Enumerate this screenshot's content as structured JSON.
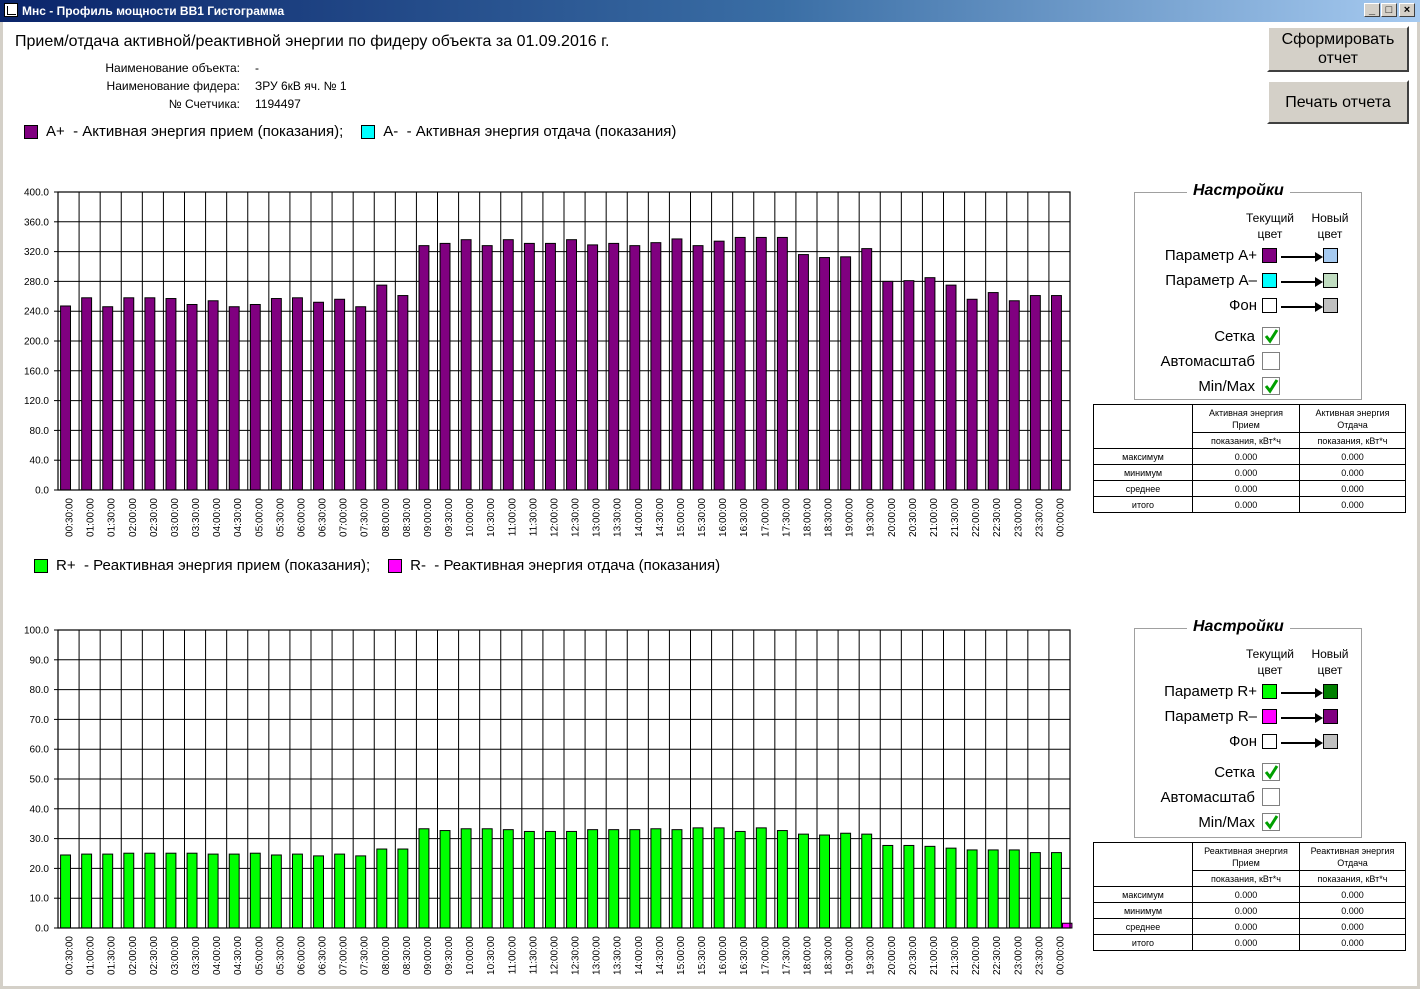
{
  "window": {
    "title": "Мнс - Профиль мощности ВВ1 Гистограмма",
    "minimize": "_",
    "maximize": "□",
    "close": "×"
  },
  "header": {
    "text": "Прием/отдача активной/реактивной энергии  по фидеру объекта за",
    "date": "01.09.2016",
    "suffix": "г."
  },
  "info": {
    "object_label": "Наименование объекта:",
    "object_value": "-",
    "feeder_label": "Наименование фидера:",
    "feeder_value": "ЗРУ 6кВ яч. № 1",
    "meter_label": "№ Счетчика:",
    "meter_value": "1194497"
  },
  "buttons": {
    "generate": "Сформировать отчет",
    "print": "Печать отчета"
  },
  "legend_active": {
    "a_plus_code": "A+",
    "a_plus_text": "-  Активная энергия прием (показания);",
    "a_minus_code": "A-",
    "a_minus_text": "-  Активная энергия отдача (показания)"
  },
  "legend_reactive": {
    "r_plus_code": "R+",
    "r_plus_text": "-  Реактивная энергия прием (показания);",
    "r_minus_code": "R-",
    "r_minus_text": "-  Реактивная энергия отдача (показания)"
  },
  "settings_active": {
    "title": "Настройки",
    "current_color_1": "Текущий",
    "current_color_2": "цвет",
    "new_color_1": "Новый",
    "new_color_2": "цвет",
    "param1": "Параметр A+",
    "param2": "Параметр A–",
    "background": "Фон",
    "grid": "Сетка",
    "autoscale": "Автомасштаб",
    "minmax": "Min/Max",
    "grid_checked": true,
    "autoscale_checked": false,
    "minmax_checked": true,
    "colors": {
      "param1_current": "#800080",
      "param1_new": "#a6caf0",
      "param2_current": "#00ffff",
      "param2_new": "#c0dcc0",
      "bg_current": "#ffffff",
      "bg_new": "#c0c0c0"
    }
  },
  "settings_reactive": {
    "title": "Настройки",
    "current_color_1": "Текущий",
    "current_color_2": "цвет",
    "new_color_1": "Новый",
    "new_color_2": "цвет",
    "param1": "Параметр R+",
    "param2": "Параметр R–",
    "background": "Фон",
    "grid": "Сетка",
    "autoscale": "Автомасштаб",
    "minmax": "Min/Max",
    "grid_checked": true,
    "autoscale_checked": false,
    "minmax_checked": true,
    "colors": {
      "param1_current": "#00ff00",
      "param1_new": "#008000",
      "param2_current": "#ff00ff",
      "param2_new": "#800080",
      "bg_current": "#ffffff",
      "bg_new": "#c0c0c0"
    }
  },
  "stats_active": {
    "col1_line1": "Активная энергия",
    "col1_line2": "Прием",
    "col2_line1": "Активная энергия",
    "col2_line2": "Отдача",
    "unit": "показания, кВт*ч",
    "rows": [
      {
        "label": "максимум",
        "v1": "0.000",
        "v2": "0.000"
      },
      {
        "label": "минимум",
        "v1": "0.000",
        "v2": "0.000"
      },
      {
        "label": "среднее",
        "v1": "0.000",
        "v2": "0.000"
      },
      {
        "label": "итого",
        "v1": "0.000",
        "v2": "0.000"
      }
    ]
  },
  "stats_reactive": {
    "col1_line1": "Реактивная энергия",
    "col1_line2": "Прием",
    "col2_line1": "Реактивная энергия",
    "col2_line2": "Отдача",
    "unit": "показания, кВт*ч",
    "rows": [
      {
        "label": "максимум",
        "v1": "0.000",
        "v2": "0.000"
      },
      {
        "label": "минимум",
        "v1": "0.000",
        "v2": "0.000"
      },
      {
        "label": "среднее",
        "v1": "0.000",
        "v2": "0.000"
      },
      {
        "label": "итого",
        "v1": "0.000",
        "v2": "0.000"
      }
    ]
  },
  "chart_data": [
    {
      "type": "bar",
      "categories": [
        "00:30:00",
        "01:00:00",
        "01:30:00",
        "02:00:00",
        "02:30:00",
        "03:00:00",
        "03:30:00",
        "04:00:00",
        "04:30:00",
        "05:00:00",
        "05:30:00",
        "06:00:00",
        "06:30:00",
        "07:00:00",
        "07:30:00",
        "08:00:00",
        "08:30:00",
        "09:00:00",
        "09:30:00",
        "10:00:00",
        "10:30:00",
        "11:00:00",
        "11:30:00",
        "12:00:00",
        "12:30:00",
        "13:00:00",
        "13:30:00",
        "14:00:00",
        "14:30:00",
        "15:00:00",
        "15:30:00",
        "16:00:00",
        "16:30:00",
        "17:00:00",
        "17:30:00",
        "18:00:00",
        "18:30:00",
        "19:00:00",
        "19:30:00",
        "20:00:00",
        "20:30:00",
        "21:00:00",
        "21:30:00",
        "22:00:00",
        "22:30:00",
        "23:00:00",
        "23:30:00",
        "00:00:00"
      ],
      "series": [
        {
          "name": "A+",
          "color": "#800080",
          "values": [
            247,
            258,
            246,
            258,
            258,
            257,
            249,
            254,
            246,
            249,
            257,
            258,
            252,
            256,
            246,
            275,
            261,
            328,
            331,
            336,
            328,
            336,
            331,
            331,
            336,
            329,
            331,
            328,
            332,
            337,
            328,
            334,
            339,
            339,
            339,
            316,
            312,
            313,
            324,
            280,
            281,
            285,
            275,
            256,
            265,
            254,
            261,
            261
          ]
        },
        {
          "name": "A-",
          "color": "#00ffff",
          "values": [
            0,
            0,
            0,
            0,
            0,
            0,
            0,
            0,
            0,
            0,
            0,
            0,
            0,
            0,
            0,
            0,
            0,
            0,
            0,
            0,
            0,
            0,
            0,
            0,
            0,
            0,
            0,
            0,
            0,
            0,
            0,
            0,
            0,
            0,
            0,
            0,
            0,
            0,
            0,
            0,
            0,
            0,
            0,
            0,
            0,
            0,
            0,
            0
          ]
        }
      ],
      "ylim": [
        0,
        400
      ],
      "yticks": [
        "0.0",
        "40.0",
        "80.0",
        "120.0",
        "160.0",
        "200.0",
        "240.0",
        "280.0",
        "320.0",
        "360.0",
        "400.0"
      ],
      "grid": true
    },
    {
      "type": "bar",
      "categories": [
        "00:30:00",
        "01:00:00",
        "01:30:00",
        "02:00:00",
        "02:30:00",
        "03:00:00",
        "03:30:00",
        "04:00:00",
        "04:30:00",
        "05:00:00",
        "05:30:00",
        "06:00:00",
        "06:30:00",
        "07:00:00",
        "07:30:00",
        "08:00:00",
        "08:30:00",
        "09:00:00",
        "09:30:00",
        "10:00:00",
        "10:30:00",
        "11:00:00",
        "11:30:00",
        "12:00:00",
        "12:30:00",
        "13:00:00",
        "13:30:00",
        "14:00:00",
        "14:30:00",
        "15:00:00",
        "15:30:00",
        "16:00:00",
        "16:30:00",
        "17:00:00",
        "17:30:00",
        "18:00:00",
        "18:30:00",
        "19:00:00",
        "19:30:00",
        "20:00:00",
        "20:30:00",
        "21:00:00",
        "21:30:00",
        "22:00:00",
        "22:30:00",
        "23:00:00",
        "23:30:00",
        "00:00:00"
      ],
      "series": [
        {
          "name": "R+",
          "color": "#00ff00",
          "values": [
            24.5,
            24.8,
            24.8,
            25.1,
            25.1,
            25.1,
            25.1,
            24.8,
            24.8,
            25.1,
            24.5,
            24.8,
            24.2,
            24.8,
            24.2,
            26.5,
            26.5,
            33.3,
            32.7,
            33.3,
            33.3,
            33.0,
            32.4,
            32.4,
            32.4,
            33.0,
            33.0,
            33.0,
            33.3,
            33.0,
            33.6,
            33.6,
            32.4,
            33.6,
            32.7,
            31.5,
            31.2,
            31.8,
            31.5,
            27.7,
            27.7,
            27.4,
            26.8,
            26.2,
            26.2,
            26.2,
            25.3,
            25.3
          ]
        },
        {
          "name": "R-",
          "color": "#ff00ff",
          "values": [
            0,
            0,
            0,
            0,
            0,
            0,
            0,
            0,
            0,
            0,
            0,
            0,
            0,
            0,
            0,
            0,
            0,
            0,
            0,
            0,
            0,
            0,
            0,
            0,
            0,
            0,
            0,
            0,
            0,
            0,
            0,
            0,
            0,
            0,
            0,
            0,
            0,
            0,
            0,
            0,
            0,
            0,
            0,
            0,
            0,
            0,
            0,
            1.6
          ]
        }
      ],
      "ylim": [
        0,
        100
      ],
      "yticks": [
        "0.0",
        "10.0",
        "20.0",
        "30.0",
        "40.0",
        "50.0",
        "60.0",
        "70.0",
        "80.0",
        "90.0",
        "100.0"
      ],
      "grid": true
    }
  ]
}
